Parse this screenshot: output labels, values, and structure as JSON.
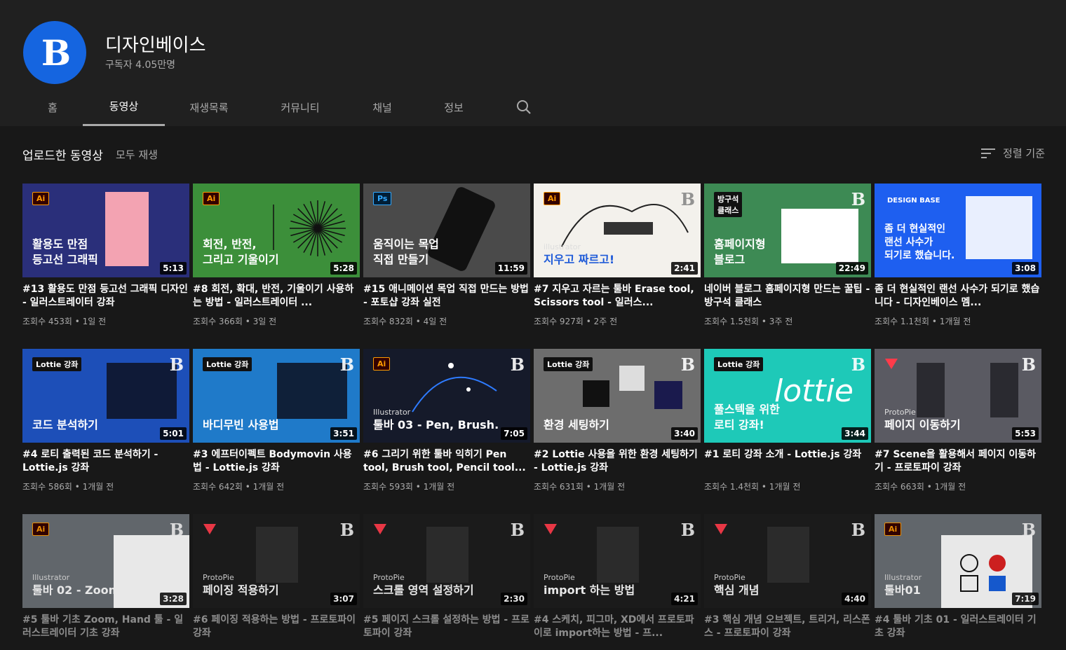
{
  "channel": {
    "name": "디자인베이스",
    "subscribers": "구독자 4.05만명",
    "avatar_letter": "B",
    "accent": "#1565e0"
  },
  "tabs": [
    "홈",
    "동영상",
    "재생목록",
    "커뮤니티",
    "채널",
    "정보"
  ],
  "section": {
    "title": "업로드한 동영상",
    "play_all": "모두 재생",
    "sort": "정렬 기준"
  },
  "videos": [
    {
      "title": "#13 활용도 만점 등고선 그래픽 디자인 - 일러스트레이터 강좌",
      "meta": "조회수 453회 • 1일 전",
      "duration": "5:13",
      "thumb_text": "활용도 만점\n등고선 그래픽",
      "badge": "Ai",
      "bg": "#2a2f7a"
    },
    {
      "title": "#8 회전, 확대, 반전, 기울이기 사용하는 방법 - 일러스트레이터 ...",
      "meta": "조회수 366회 • 3일 전",
      "duration": "5:28",
      "thumb_text": "회전, 반전,\n그리고 기울이기",
      "badge": "Ai",
      "bg": "#3c8f3a"
    },
    {
      "title": "#15 애니메이션 목업 직접 만드는 방법 - 포토샵 강좌 실전",
      "meta": "조회수 832회 • 4일 전",
      "duration": "11:59",
      "thumb_text": "움직이는 목업\n직접 만들기",
      "badge": "Ps",
      "bg": "#4a4a4a"
    },
    {
      "title": "#7 지우고 자르는 툴바 Erase tool, Scissors tool - 일러스...",
      "meta": "조회수 927회 • 2주 전",
      "duration": "2:41",
      "thumb_text": "지우고 짜르고!",
      "thumb_sub": "illustrator",
      "badge": "Ai",
      "bg": "#f3f1ec"
    },
    {
      "title": "네이버 블로그 홈페이지형 만드는 꿀팁 - 방구석 클래스",
      "meta": "조회수 1.5천회 • 3주 전",
      "duration": "22:49",
      "thumb_text": "홈페이지형\n블로그",
      "badge": "방구석\n클래스",
      "bg": "#3d8a54"
    },
    {
      "title": "좀 더 현실적인 랜선 사수가 되기로 했습니다 - 디자인베이스 멤...",
      "meta": "조회수 1.1천회 • 1개월 전",
      "duration": "3:08",
      "thumb_text": "좀 더 현실적인\n랜선 사수가\n되기로 했습니다.",
      "thumb_sub": "DESIGN BASE",
      "bg": "#1e5ff0"
    },
    {
      "title": "#4 로티 출력된 코드 분석하기 - Lottie.js 강좌",
      "meta": "조회수 586회 • 1개월 전",
      "duration": "5:01",
      "thumb_text": "코드 분석하기",
      "badge": "Lottie 강좌",
      "bg": "#1d4fb8"
    },
    {
      "title": "#3 에프터이펙트 Bodymovin 사용법 - Lottie.js 강좌",
      "meta": "조회수 642회 • 1개월 전",
      "duration": "3:51",
      "thumb_text": "바디무빈 사용법",
      "badge": "Lottie 강좌",
      "bg": "#1f7ac9"
    },
    {
      "title": "#6 그리기 위한 툴바 익히기 Pen tool, Brush tool, Pencil tool...",
      "meta": "조회수 593회 • 1개월 전",
      "duration": "7:05",
      "thumb_text": "툴바 03 - Pen, Brush.",
      "thumb_sub": "Illustrator",
      "badge": "Ai",
      "bg": "#151a2a"
    },
    {
      "title": "#2 Lottie 사용을 위한 환경 세팅하기 - Lottie.js 강좌",
      "meta": "조회수 631회 • 1개월 전",
      "duration": "3:40",
      "thumb_text": "환경 세팅하기",
      "badge": "Lottie 강좌",
      "bg": "#6d6d6d"
    },
    {
      "title": "#1 로티 강좌 소개 - Lottie.js 강좌",
      "meta": "조회수 1.4천회 • 1개월 전",
      "duration": "3:44",
      "thumb_text": "풀스텍을 위한\n로티 강좌!",
      "badge": "Lottie 강좌",
      "bg": "#1ec9b8"
    },
    {
      "title": "#7 Scene을 활용해서 페이지 이동하기 - 프로토파이 강좌",
      "meta": "조회수 663회 • 1개월 전",
      "duration": "5:53",
      "thumb_text": "페이지 이동하기",
      "thumb_sub": "ProtoPie",
      "bg": "#5a5a62"
    },
    {
      "title": "#5 툴바 기초 Zoom, Hand 툴 - 일러스트레이터 기초 강좌",
      "meta": "",
      "duration": "3:28",
      "thumb_text": "툴바 02 - Zoom, Hand",
      "thumb_sub": "Illustrator",
      "badge": "Ai",
      "bg": "#6a6f75"
    },
    {
      "title": "#6 페이징 적용하는 방법 - 프로토파이 강좌",
      "meta": "",
      "duration": "3:07",
      "thumb_text": "페이징 적용하기",
      "thumb_sub": "ProtoPie",
      "bg": "#1c1c1c"
    },
    {
      "title": "#5 페이지 스크롤 설정하는 방법 - 프로토파이 강좌",
      "meta": "",
      "duration": "2:30",
      "thumb_text": "스크롤 영역 설정하기",
      "thumb_sub": "ProtoPie",
      "bg": "#1c1c1c"
    },
    {
      "title": "#4 스케치, 피그마, XD에서 프로토파이로 import하는 방법 - 프...",
      "meta": "",
      "duration": "4:21",
      "thumb_text": "import 하는 방법",
      "thumb_sub": "ProtoPie",
      "bg": "#1c1c1c"
    },
    {
      "title": "#3 핵심 개념 오브젝트, 트리거, 리스폰스 - 프로토파이 강좌",
      "meta": "",
      "duration": "4:40",
      "thumb_text": "핵심 개념",
      "thumb_sub": "ProtoPie",
      "bg": "#1c1c1c"
    },
    {
      "title": "#4 툴바 기초 01 - 일러스트레이터 기초 강좌",
      "meta": "",
      "duration": "7:19",
      "thumb_text": "툴바01",
      "thumb_sub": "Illustrator",
      "badge": "Ai",
      "bg": "#6a6f75"
    }
  ]
}
